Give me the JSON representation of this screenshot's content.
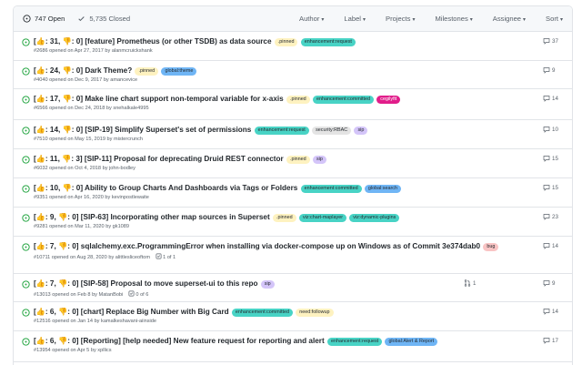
{
  "header": {
    "open_label": "747 Open",
    "closed_label": "5,735 Closed",
    "filters": [
      "Author",
      "Label",
      "Projects",
      "Milestones",
      "Assignee",
      "Sort"
    ]
  },
  "issues": [
    {
      "title": "[👍: 31, 👎: 0] [feature] Prometheus (or other TSDB) as data source",
      "labels": [
        {
          "name": ".pinned",
          "bg": "#fef2c0",
          "fg": "#24292e"
        },
        {
          "name": "enhancement:request",
          "bg": "#48d3c5",
          "fg": "#24292e"
        }
      ],
      "meta": "#2686 opened on Apr 27, 2017 by alanmcruickshank",
      "comments": "37",
      "h": 32
    },
    {
      "title": "[👍: 24, 👎: 0] Dark Theme?",
      "labels": [
        {
          "name": ".pinned",
          "bg": "#fef2c0",
          "fg": "#24292e"
        },
        {
          "name": "global:theme",
          "bg": "#6fb5f5",
          "fg": "#24292e"
        }
      ],
      "meta": "#4040 opened on Dec 9, 2017 by amancevice",
      "comments": "9",
      "h": 31
    },
    {
      "title": "[👍: 17, 👎: 0] Make line chart support non-temporal variable for x-axis",
      "labels": [
        {
          "name": ".pinned",
          "bg": "#fef2c0",
          "fg": "#24292e"
        },
        {
          "name": "enhancement:committed",
          "bg": "#48d3c5",
          "fg": "#24292e"
        },
        {
          "name": "cegilyfit",
          "bg": "#e11d8a",
          "fg": "#ffffff"
        }
      ],
      "meta": "#6566 opened on Dec 24, 2018 by snehalkale4995",
      "comments": "14",
      "h": 34
    },
    {
      "title": "[👍: 14, 👎: 0] [SIP-19] Simplify Superset's set of permissions",
      "labels": [
        {
          "name": "enhancement:request",
          "bg": "#48d3c5",
          "fg": "#24292e"
        },
        {
          "name": "security:RBAC",
          "bg": "#e4e4e4",
          "fg": "#24292e"
        },
        {
          "name": "sip",
          "bg": "#d4c5f9",
          "fg": "#24292e"
        }
      ],
      "meta": "#7510 opened on May 15, 2019 by mistercrunch",
      "comments": "10",
      "h": 32
    },
    {
      "title": "[👍: 11, 👎: 3] [SIP-11] Proposal for deprecating Druid REST connector",
      "labels": [
        {
          "name": ".pinned",
          "bg": "#fef2c0",
          "fg": "#24292e"
        },
        {
          "name": "sip",
          "bg": "#d4c5f9",
          "fg": "#24292e"
        }
      ],
      "meta": "#6032 opened on Oct 4, 2018 by john-bodley",
      "comments": "15",
      "h": 32
    },
    {
      "title": "[👍: 10, 👎: 0] Ability to Group Charts And Dashboards via Tags or Folders",
      "labels": [
        {
          "name": "enhancement:committed",
          "bg": "#48d3c5",
          "fg": "#24292e"
        },
        {
          "name": "global:search",
          "bg": "#6fb5f5",
          "fg": "#24292e"
        }
      ],
      "meta": "#9351 opened on Apr 16, 2020 by kevinpostlewaite",
      "comments": "15",
      "h": 32
    },
    {
      "title": "[👍: 9, 👎: 0] [SIP-63] Incorporating other map sources in Superset",
      "labels": [
        {
          "name": ".pinned",
          "bg": "#fef2c0",
          "fg": "#24292e"
        },
        {
          "name": "viz:chart-maplayer",
          "bg": "#48d3c5",
          "fg": "#24292e"
        },
        {
          "name": "viz:dynamic-plugins",
          "bg": "#48d3c5",
          "fg": "#24292e"
        }
      ],
      "meta": "#9281 opened on Mar 11, 2020 by gk1089",
      "comments": "23",
      "h": 32
    },
    {
      "title": "[👍: 7, 👎: 0] sqlalchemy.exc.ProgrammingError when installing via docker-compose up on Windows as of Commit 3e374dab0",
      "labels": [
        {
          "name": "bug",
          "bg": "#f9c4c4",
          "fg": "#24292e"
        }
      ],
      "meta": "#10711 opened on Aug 28, 2020 by alittlesliceoftom",
      "progress": "1 of 1",
      "comments": "14",
      "h": 41
    },
    {
      "title": "[👍: 7, 👎: 0] [SIP-58] Proposal to move superset-ui to this repo",
      "labels": [
        {
          "name": "sip",
          "bg": "#d4c5f9",
          "fg": "#24292e"
        }
      ],
      "meta": "#13013 opened on Feb 8 by MatanBobi",
      "progress": "0 of 6",
      "pr": "1",
      "comments": "9",
      "h": 31
    },
    {
      "title": "[👍: 6, 👎: 0] [chart] Replace Big Number with Big Card",
      "labels": [
        {
          "name": "enhancement:committed",
          "bg": "#48d3c5",
          "fg": "#24292e"
        },
        {
          "name": "need:followup",
          "bg": "#fef2c0",
          "fg": "#24292e"
        }
      ],
      "meta": "#12516 opened on Jan 14 by kamalkeshavani-aiinside",
      "comments": "14",
      "h": 32
    },
    {
      "title": "[👍: 6, 👎: 0] [Reporting] [help needed] New feature request for reporting and alert",
      "labels": [
        {
          "name": "enhancement:request",
          "bg": "#48d3c5",
          "fg": "#24292e"
        },
        {
          "name": "global:Alert & Report",
          "bg": "#6fb5f5",
          "fg": "#24292e"
        }
      ],
      "meta": "#13954 opened on Apr 5 by xpllics",
      "comments": "17",
      "h": 34
    }
  ]
}
